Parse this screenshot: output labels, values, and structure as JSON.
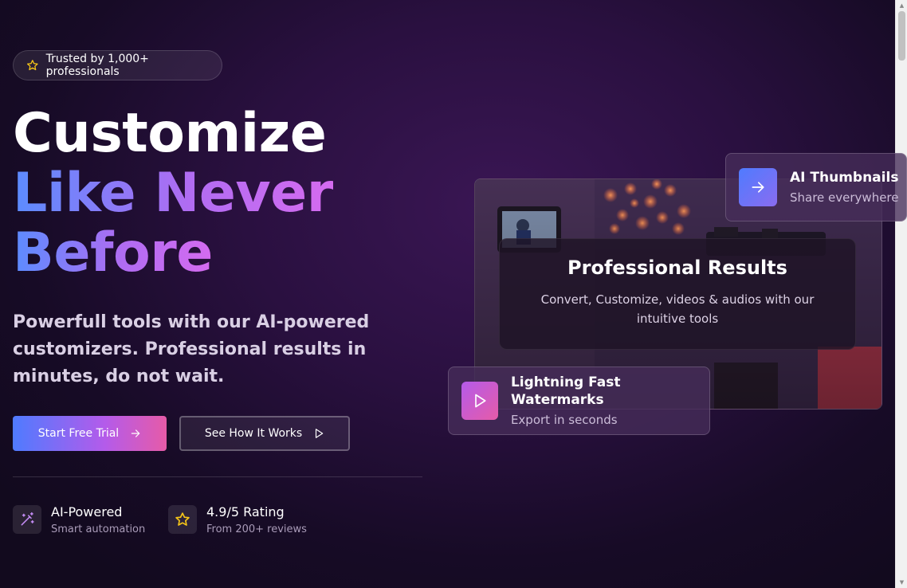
{
  "badge": {
    "icon": "star-icon",
    "label": "Trusted by 1,000+ professionals"
  },
  "hero": {
    "line1": "Customize",
    "line2": "Like Never",
    "line3": "Before",
    "subtitle": "Powerfull tools with our AI-powered customizers. Professional results in minutes, do not wait."
  },
  "buttons": {
    "primary_label": "Start Free Trial",
    "primary_icon": "arrow-right-icon",
    "secondary_label": "See How It Works",
    "secondary_icon": "play-icon"
  },
  "features": [
    {
      "icon": "magic-wand-icon",
      "title": "AI-Powered",
      "subtitle": "Smart automation"
    },
    {
      "icon": "star-icon",
      "title": "4.9/5 Rating",
      "subtitle": "From 200+ reviews"
    }
  ],
  "showcase": {
    "main_title": "Professional Results",
    "main_desc": "Convert, Customize, videos & audios with our intuitive tools",
    "card_top": {
      "icon": "arrow-right-icon",
      "title": "AI Thumbnails",
      "subtitle": "Share everywhere"
    },
    "card_bottom": {
      "icon": "play-icon",
      "title": "Lightning Fast Watermarks",
      "subtitle": "Export in seconds"
    }
  },
  "colors": {
    "accent_blue": "#4f7bff",
    "accent_purple": "#b45bea",
    "accent_pink": "#e65ba8",
    "star_yellow": "#f5c518"
  }
}
